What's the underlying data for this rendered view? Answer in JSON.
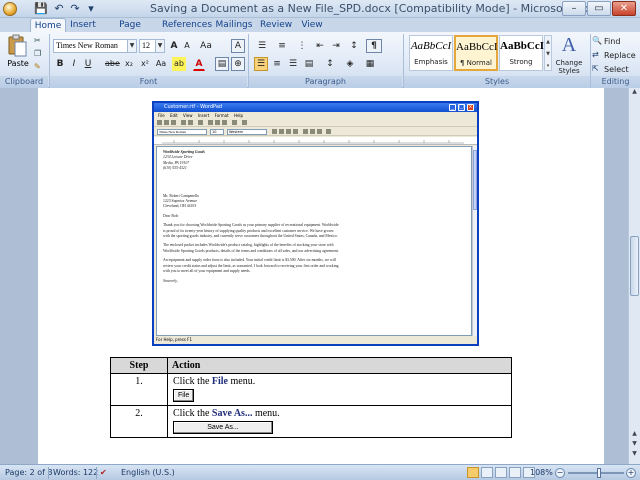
{
  "window": {
    "title": "Saving a Document as a New File_SPD.docx [Compatibility Mode] - Microsoft Word",
    "controls": {
      "minimize": "–",
      "maximize": "▭",
      "close": "✕"
    }
  },
  "quick_access": {
    "save": "💾",
    "undo": "↶",
    "redo": "↷",
    "more": "▾"
  },
  "tabs": [
    "Home",
    "Insert",
    "Page Layout",
    "References",
    "Mailings",
    "Review",
    "View"
  ],
  "active_tab": "Home",
  "ribbon": {
    "clipboard": {
      "label": "Clipboard",
      "paste": "Paste"
    },
    "font": {
      "label": "Font",
      "font_name": "Times New Roman",
      "font_size": "12",
      "buttons_row1": [
        "A",
        "A",
        "Aa",
        "A"
      ],
      "buttons_row2": [
        "B",
        "I",
        "U",
        "abe",
        "x₂",
        "x²",
        "Aa",
        "ab",
        "A"
      ]
    },
    "paragraph": {
      "label": "Paragraph",
      "pilcrow": "¶"
    },
    "styles": {
      "label": "Styles",
      "items": [
        {
          "sample": "AaBbCcI",
          "name": "Emphasis"
        },
        {
          "sample": "AaBbCcI",
          "name": "¶ Normal"
        },
        {
          "sample": "AaBbCcI",
          "name": "Strong"
        }
      ],
      "change_styles": "Change Styles"
    },
    "editing": {
      "label": "Editing",
      "find": "Find",
      "replace": "Replace",
      "select": "Select"
    }
  },
  "wordpad": {
    "title": "Customer.rtf - WordPad",
    "menu": [
      "File",
      "Edit",
      "View",
      "Insert",
      "Format",
      "Help"
    ],
    "font_name": "Times New Roman",
    "font_size": "10",
    "script": "Western",
    "status": "For Help, press F1",
    "letter": {
      "company": "Worldwide Sporting Goods",
      "address": [
        "1234 Leisure Drive",
        "Media, PA 19107",
        "(610) 555-4321"
      ],
      "recipient": [
        "Mr. Robert Campanella",
        "1223 Superior Avenue",
        "Cleveland, OH 44103"
      ],
      "salutation": "Dear Bob:",
      "paragraphs": [
        "Thank you for choosing Worldwide Sporting Goods as your primary supplier of recreational equipment. Worldwide is proud of its twenty-year history of supplying quality products and excellent customer service. We have grown with the sporting goods industry, and currently serve customers throughout the United States, Canada, and Mexico.",
        "The enclosed packet includes Worldwide's product catalog, highlights of the benefits of stocking your store with Worldwide Sporting Goods products, details of the terms and conditions of all sales, and our advertising agreement.",
        "An equipment and supply order form is also included. Your initial credit limit is $3,500. After six months, we will review your credit status and adjust the limit, as warranted. I look forward to receiving your first order and working with you to meet all of your equipment and supply needs."
      ],
      "closing": "Sincerely,"
    }
  },
  "steps_table": {
    "headers": {
      "step": "Step",
      "action": "Action"
    },
    "rows": [
      {
        "num": "1.",
        "prefix": "Click the ",
        "keyword": "File",
        "suffix": " menu.",
        "button": "File"
      },
      {
        "num": "2.",
        "prefix": "Click the ",
        "keyword": "Save As...",
        "suffix": " menu.",
        "button": "Save As..."
      }
    ]
  },
  "statusbar": {
    "page": "Page: 2 of 3",
    "words": "Words: 122",
    "language": "English (U.S.)",
    "zoom": "108%"
  },
  "colors": {
    "accent": "#15428b",
    "wordpad_title": "#1250d0",
    "keyword": "#1f2c7a"
  }
}
